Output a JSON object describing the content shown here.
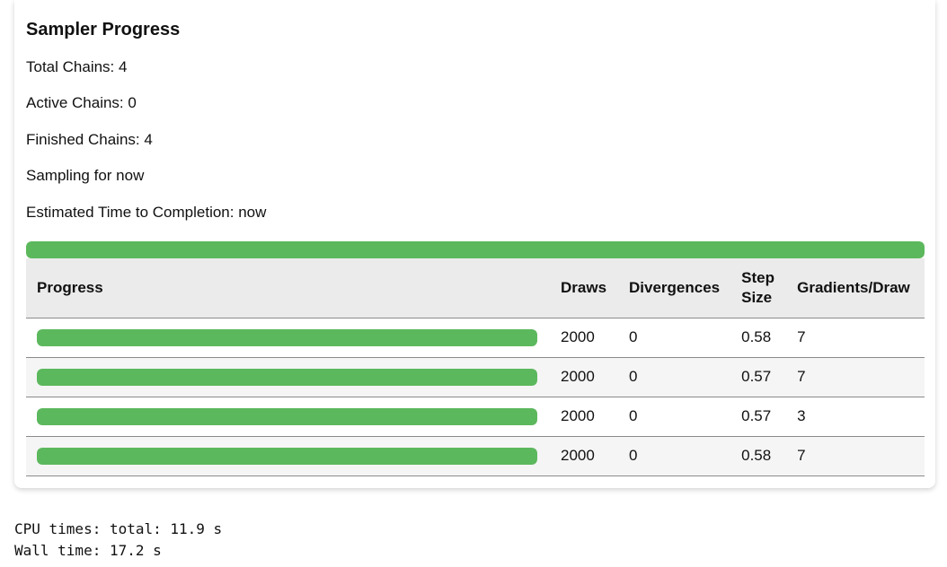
{
  "panel": {
    "title": "Sampler Progress",
    "total_chains": "Total Chains: 4",
    "active_chains": "Active Chains: 0",
    "finished_chains": "Finished Chains: 4",
    "sampling_for": "Sampling for now",
    "eta": "Estimated Time to Completion: now",
    "overall_progress": 1.0,
    "colors": {
      "bar_fill": "#5cb85c",
      "header_bg": "#ebebeb",
      "stripe_bg": "#f5f5f5"
    }
  },
  "table": {
    "headers": {
      "progress": "Progress",
      "draws": "Draws",
      "divergences": "Divergences",
      "step_size": "Step Size",
      "gradients": "Gradients/Draw"
    },
    "rows": [
      {
        "progress": 1.0,
        "draws": "2000",
        "divergences": "0",
        "step_size": "0.58",
        "gradients": "7"
      },
      {
        "progress": 1.0,
        "draws": "2000",
        "divergences": "0",
        "step_size": "0.57",
        "gradients": "7"
      },
      {
        "progress": 1.0,
        "draws": "2000",
        "divergences": "0",
        "step_size": "0.57",
        "gradients": "3"
      },
      {
        "progress": 1.0,
        "draws": "2000",
        "divergences": "0",
        "step_size": "0.58",
        "gradients": "7"
      }
    ]
  },
  "output": {
    "cpu_times": "CPU times: total: 11.9 s",
    "wall_time": "Wall time: 17.2 s"
  }
}
